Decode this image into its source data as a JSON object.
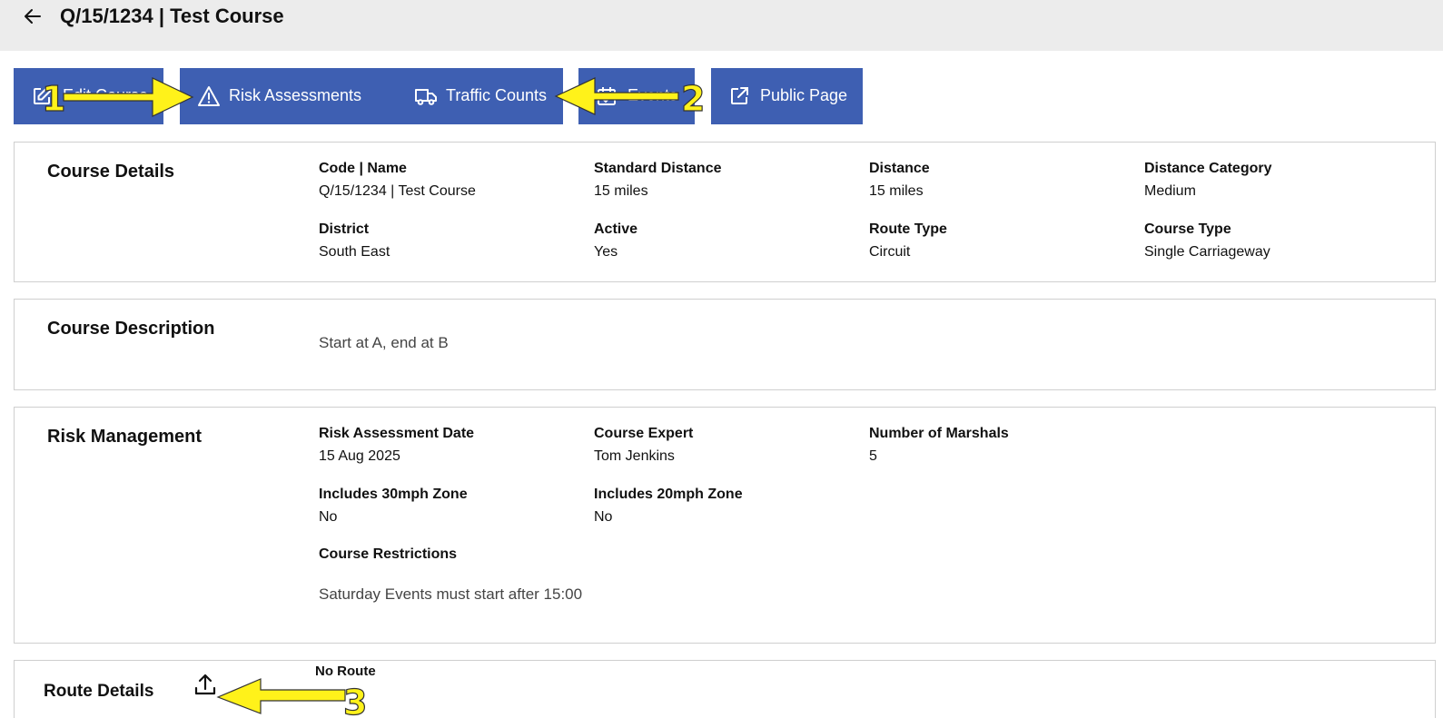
{
  "header": {
    "title": "Q/15/1234 | Test Course",
    "back_icon": "arrow-left-icon"
  },
  "toolbar": {
    "edit_label": "Edit Course",
    "risk_label": "Risk Assessments",
    "traffic_label": "Traffic Counts",
    "events_label": "Events",
    "public_label": "Public Page",
    "button_color": "#3e5fb2"
  },
  "course_details": {
    "title": "Course Details",
    "fields": [
      {
        "label": "Code | Name",
        "value": "Q/15/1234 | Test Course"
      },
      {
        "label": "Standard Distance",
        "value": "15 miles"
      },
      {
        "label": "Distance",
        "value": "15 miles"
      },
      {
        "label": "Distance Category",
        "value": "Medium"
      },
      {
        "label": "District",
        "value": "South East"
      },
      {
        "label": "Active",
        "value": "Yes"
      },
      {
        "label": "Route Type",
        "value": "Circuit"
      },
      {
        "label": "Course Type",
        "value": "Single Carriageway"
      }
    ]
  },
  "course_description": {
    "title": "Course Description",
    "text": "Start at A, end at B"
  },
  "risk_management": {
    "title": "Risk Management",
    "fields": [
      {
        "label": "Risk Assessment Date",
        "value": "15 Aug 2025"
      },
      {
        "label": "Course Expert",
        "value": "Tom Jenkins"
      },
      {
        "label": "Number of Marshals",
        "value": "5"
      },
      {
        "label": "Includes 30mph Zone",
        "value": "No"
      },
      {
        "label": "Includes 20mph Zone",
        "value": "No"
      }
    ],
    "restrictions_label": "Course Restrictions",
    "restrictions_text": "Saturday Events must start after 15:00"
  },
  "route_details": {
    "title": "Route Details",
    "empty_text": "No Route",
    "upload_icon": "upload-icon"
  },
  "annotations": {
    "color": "#fff21a",
    "labels": [
      "1",
      "2",
      "3"
    ]
  }
}
